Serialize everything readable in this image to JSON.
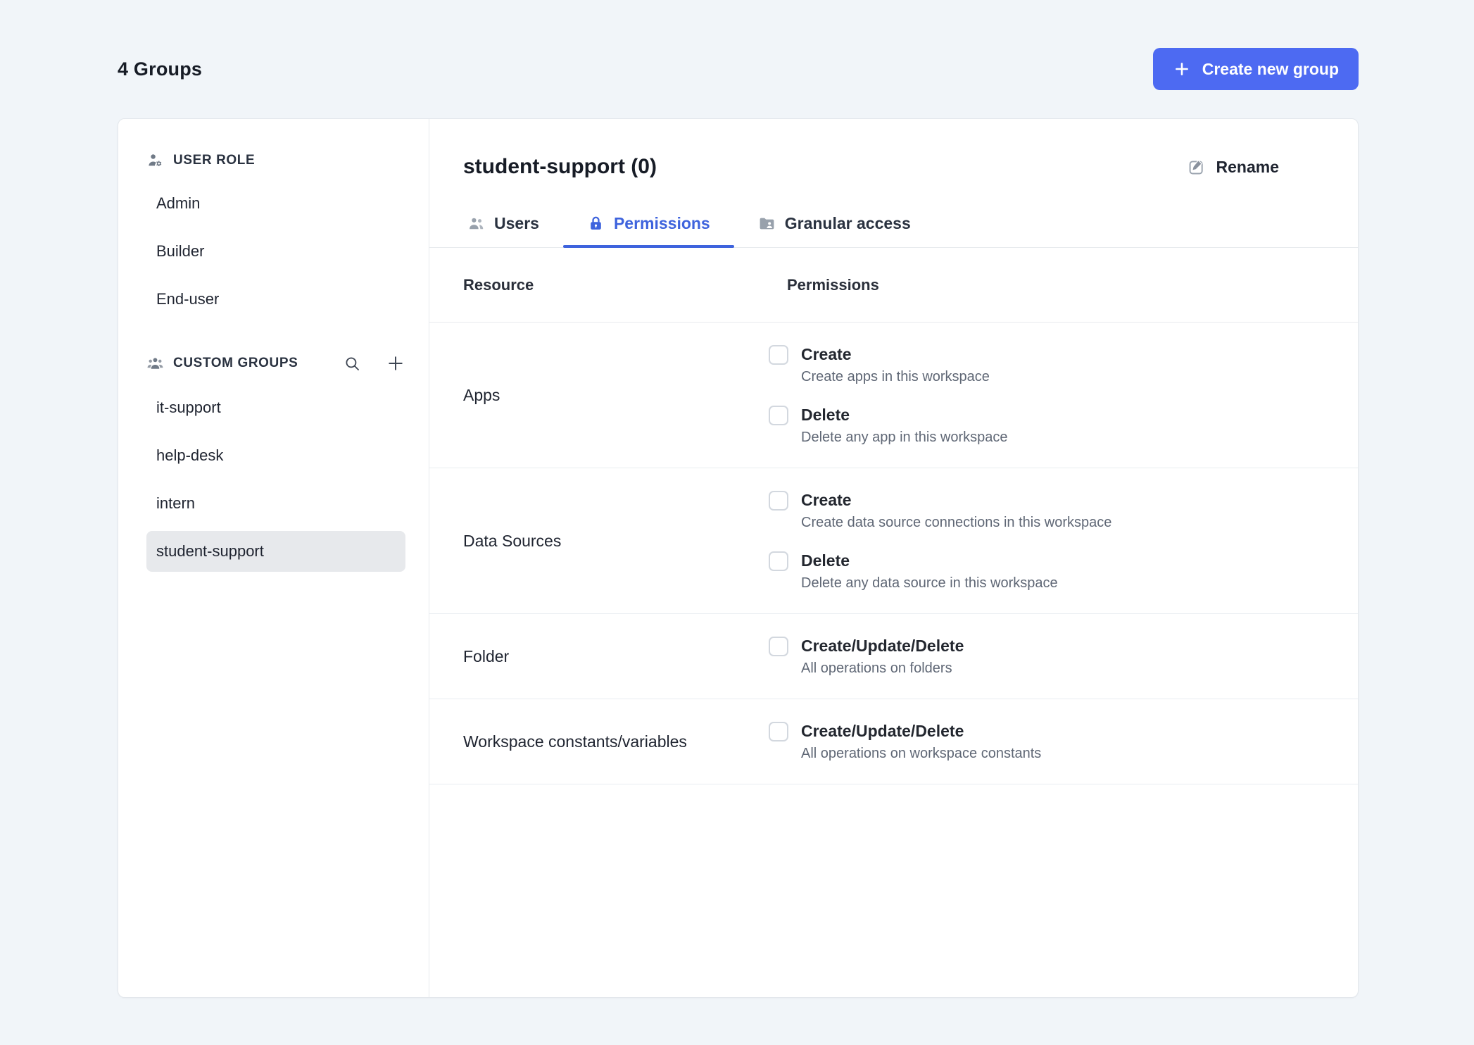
{
  "colors": {
    "accent": "#4D6AF2",
    "tab_active": "#3E63DD",
    "background": "#F1F5F9",
    "selected_item_bg": "#E7E9EC"
  },
  "icons": {
    "user_role": "user-gear-icon",
    "custom_groups": "users-group-icon",
    "search": "search-icon",
    "add_group": "plus-icon",
    "users_tab": "users-icon",
    "permissions_tab": "lock-icon",
    "granular_tab": "folder-user-icon",
    "rename": "pencil-square-icon",
    "create_button": "plus-icon"
  },
  "header": {
    "title": "4 Groups",
    "create_button": "Create new group"
  },
  "sidebar": {
    "user_role": {
      "title": "USER ROLE",
      "items": [
        {
          "label": "Admin"
        },
        {
          "label": "Builder"
        },
        {
          "label": "End-user"
        }
      ]
    },
    "custom_groups": {
      "title": "CUSTOM GROUPS",
      "items": [
        {
          "label": "it-support"
        },
        {
          "label": "help-desk"
        },
        {
          "label": "intern"
        },
        {
          "label": "student-support",
          "selected": true
        }
      ]
    }
  },
  "panel": {
    "title": "student-support (0)",
    "rename_label": "Rename",
    "tabs": [
      {
        "label": "Users",
        "active": false
      },
      {
        "label": "Permissions",
        "active": true
      },
      {
        "label": "Granular access",
        "active": false
      }
    ],
    "table": {
      "resource_header": "Resource",
      "permissions_header": "Permissions",
      "rows": [
        {
          "resource": "Apps",
          "permissions": [
            {
              "label": "Create",
              "description": "Create apps in this workspace",
              "checked": false
            },
            {
              "label": "Delete",
              "description": "Delete any app in this workspace",
              "checked": false
            }
          ]
        },
        {
          "resource": "Data Sources",
          "permissions": [
            {
              "label": "Create",
              "description": "Create data source connections in this workspace",
              "checked": false
            },
            {
              "label": "Delete",
              "description": "Delete any data source in this workspace",
              "checked": false
            }
          ]
        },
        {
          "resource": "Folder",
          "permissions": [
            {
              "label": "Create/Update/Delete",
              "description": "All operations on folders",
              "checked": false
            }
          ]
        },
        {
          "resource": "Workspace constants/variables",
          "permissions": [
            {
              "label": "Create/Update/Delete",
              "description": "All operations on workspace constants",
              "checked": false
            }
          ]
        }
      ]
    }
  }
}
